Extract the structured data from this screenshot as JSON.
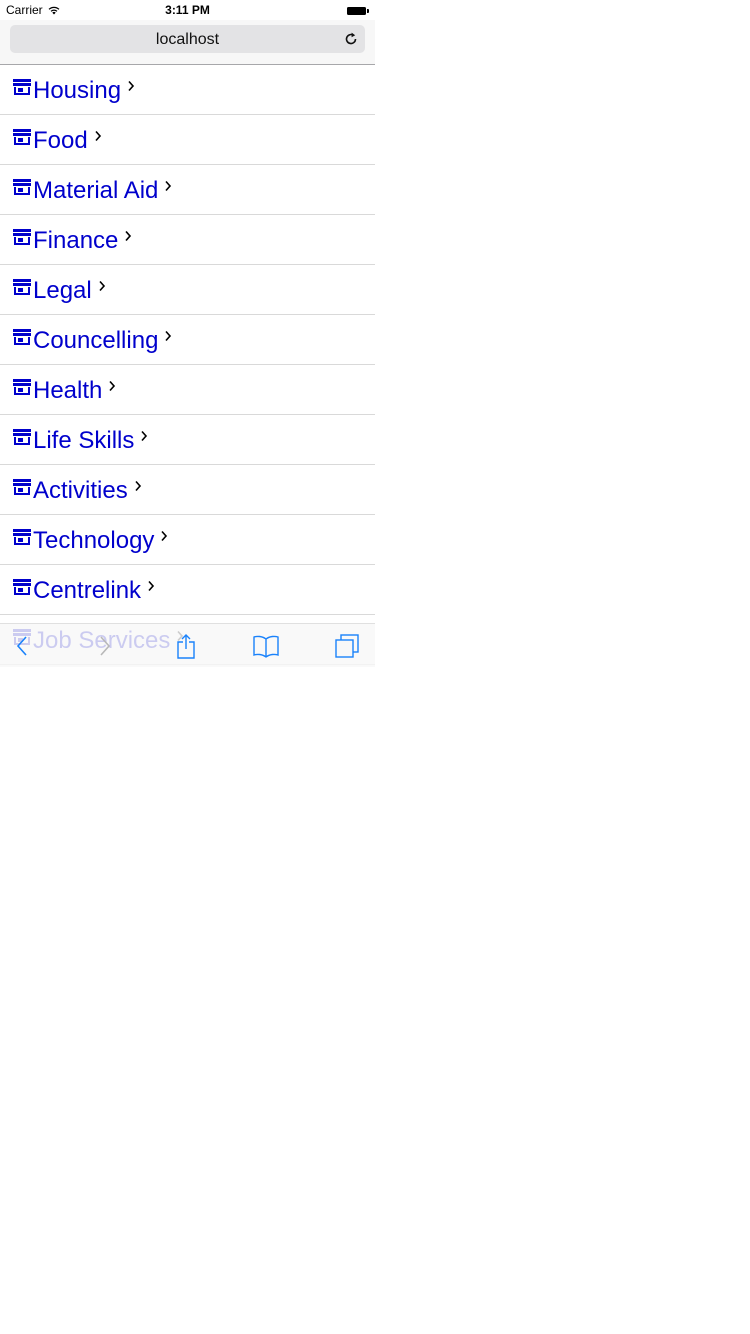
{
  "status_bar": {
    "carrier": "Carrier",
    "time": "3:11 PM"
  },
  "address_bar": {
    "url": "localhost"
  },
  "categories": [
    {
      "label": "Housing",
      "icon": "store-icon"
    },
    {
      "label": "Food",
      "icon": "store-icon"
    },
    {
      "label": "Material Aid",
      "icon": "store-icon"
    },
    {
      "label": "Finance",
      "icon": "store-icon"
    },
    {
      "label": "Legal",
      "icon": "store-icon"
    },
    {
      "label": "Councelling",
      "icon": "store-icon"
    },
    {
      "label": "Health",
      "icon": "store-icon"
    },
    {
      "label": "Life Skills",
      "icon": "store-icon"
    },
    {
      "label": "Activities",
      "icon": "store-icon"
    },
    {
      "label": "Technology",
      "icon": "store-icon"
    },
    {
      "label": "Centrelink",
      "icon": "store-icon"
    },
    {
      "label": "Job Services",
      "icon": "store-icon"
    }
  ],
  "toolbar": {
    "buttons": [
      "back-icon",
      "forward-icon",
      "share-icon",
      "bookmarks-icon",
      "tabs-icon"
    ]
  },
  "colors": {
    "link": "#0000cc",
    "toolbar_accent": "#1a82fb"
  }
}
